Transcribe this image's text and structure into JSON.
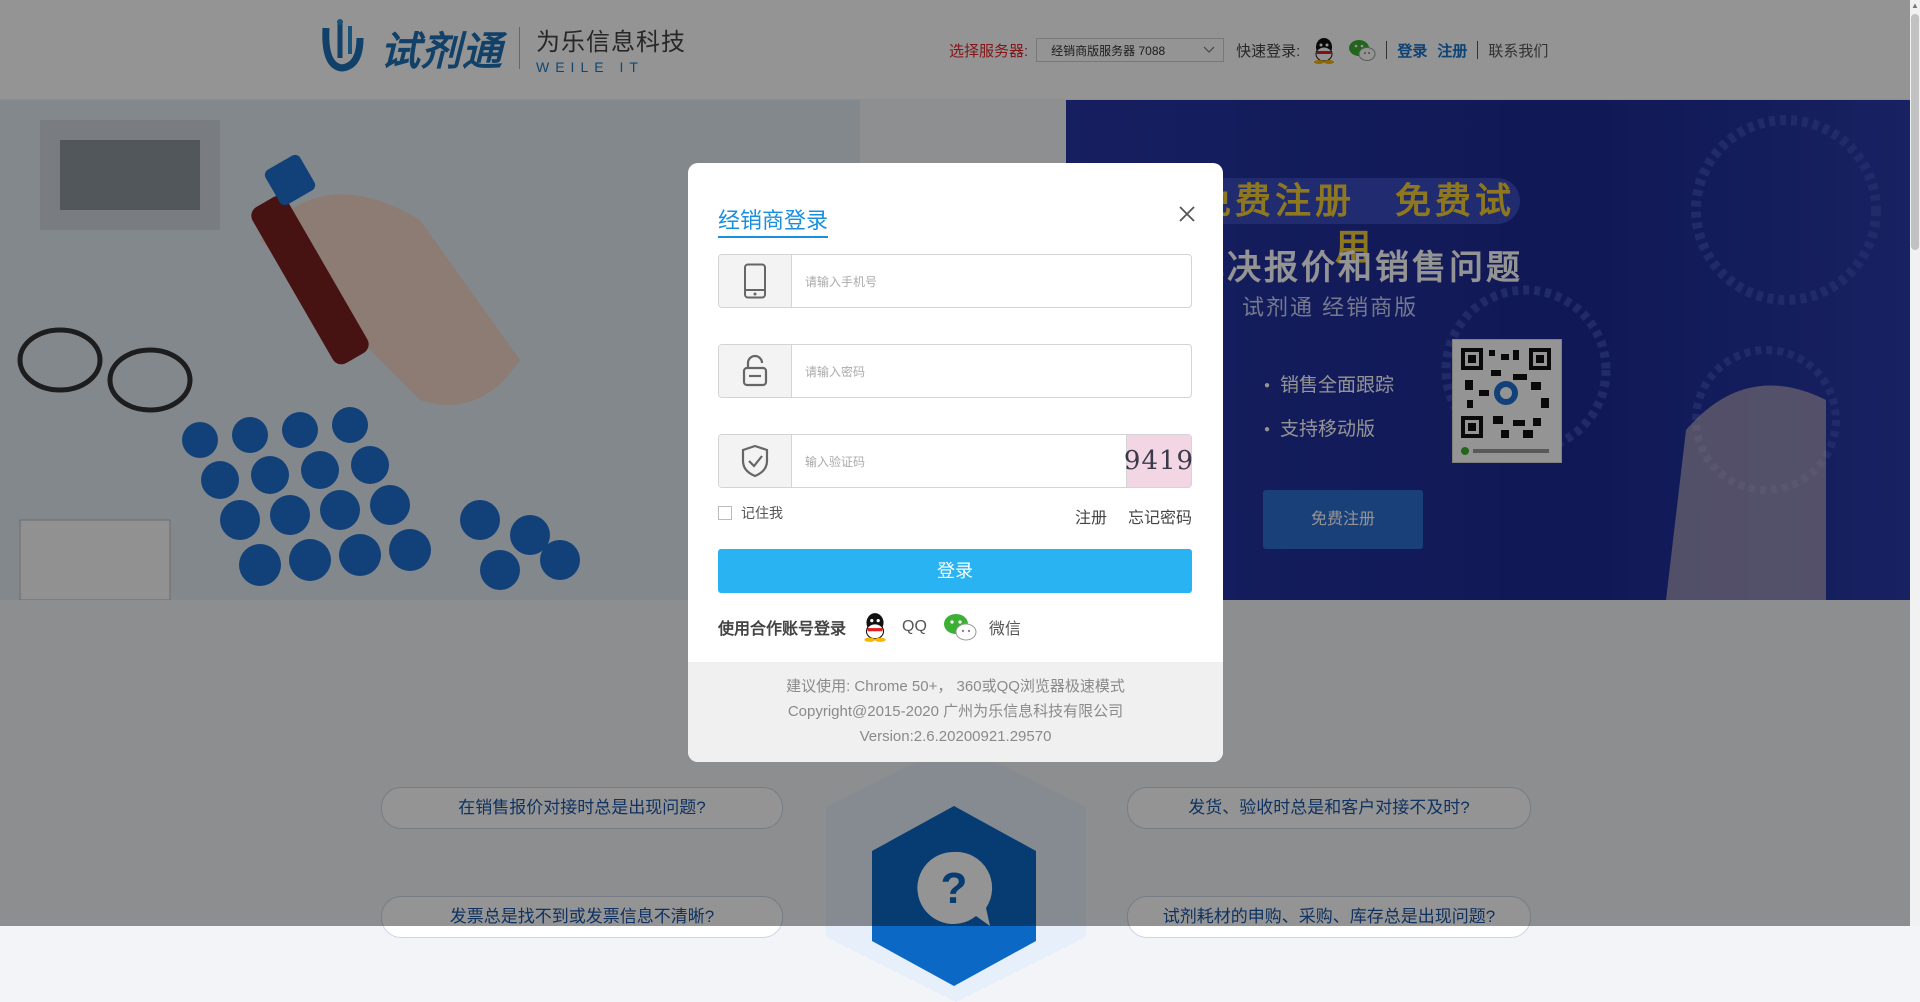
{
  "header": {
    "logo_name": "试剂通",
    "company_cn": "为乐信息科技",
    "company_en": "WEILE IT",
    "server_label": "选择服务器:",
    "server_value": "经销商版服务器 7088",
    "quick_login_label": "快速登录:",
    "login_link": "登录",
    "register_link": "注册",
    "contact_link": "联系我们"
  },
  "banner": {
    "promo_line1": "免费注册　免费试用",
    "promo_line2": "解决报价和销售问题",
    "promo_line3": "试剂通 经销商版",
    "features": [
      "销售全面跟踪",
      "支持移动版"
    ],
    "free_register_button": "免费注册"
  },
  "questions": [
    "在销售报价对接时总是出现问题?",
    "发货、验收时总是和客户对接不及时?",
    "发票总是找不到或发票信息不清晰?",
    "试剂耗材的申购、采购、库存总是出现问题?"
  ],
  "dialog": {
    "title": "经销商登录",
    "phone_placeholder": "请输入手机号",
    "password_placeholder": "请输入密码",
    "captcha_placeholder": "输入验证码",
    "captcha_text": "9419",
    "remember_label": "记住我",
    "register_link": "注册",
    "forgot_link": "忘记密码",
    "login_button": "登录",
    "partner_label": "使用合作账号登录",
    "partner_qq": "QQ",
    "partner_wechat": "微信",
    "footer_line1": "建议使用: Chrome 50+， 360或QQ浏览器极速模式",
    "footer_line2": "Copyright@2015-2020 广州为乐信息科技有限公司",
    "footer_line3": "Version:2.6.20200921.29570"
  },
  "colors": {
    "accent": "#29b3f2",
    "title_blue": "#1a8fe0",
    "server_label_red": "#e0262c",
    "banner_blue": "#1c2a93",
    "promo_yellow": "#f5cd3a"
  }
}
